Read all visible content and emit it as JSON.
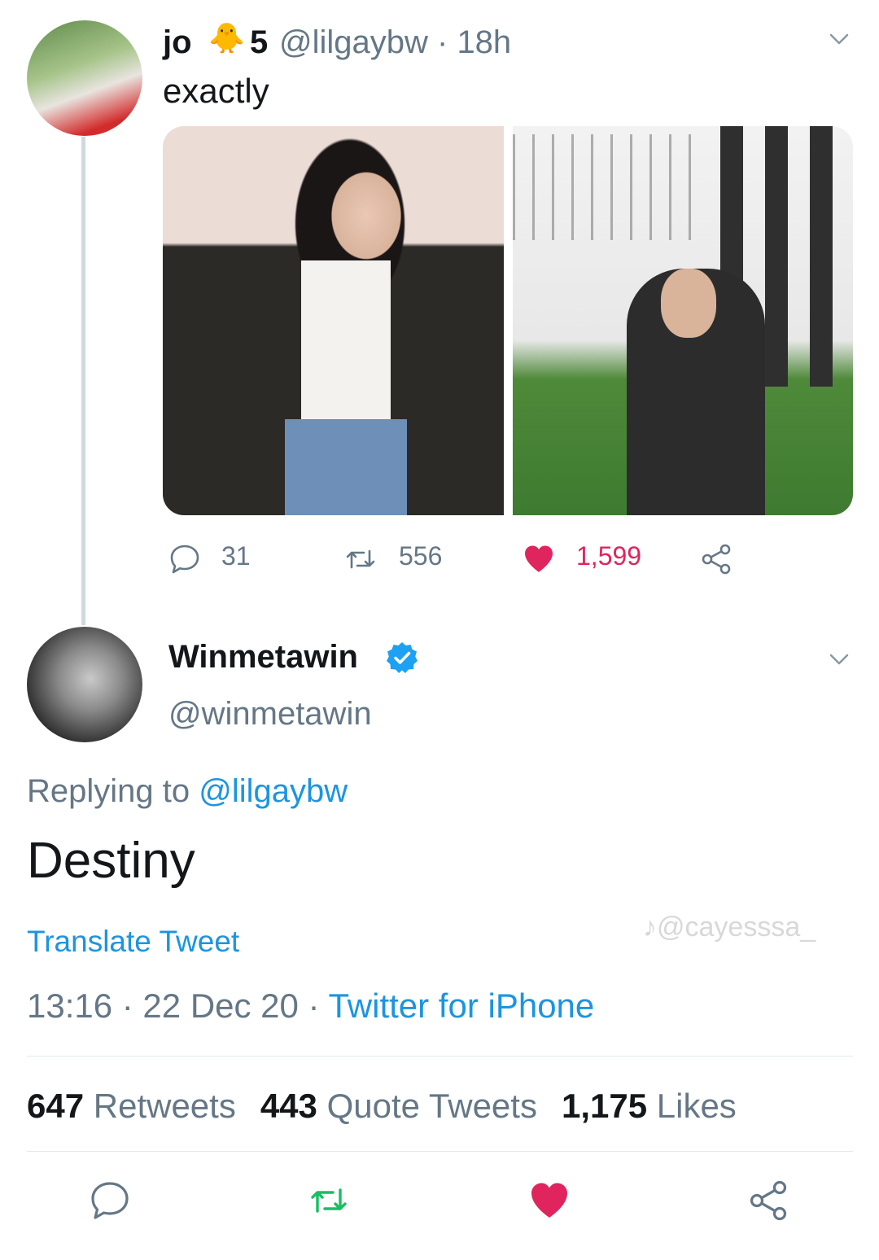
{
  "tweet1": {
    "name": "jo",
    "emoji": "🐥",
    "badge_number": "5",
    "handle_time": "@lilgaybw · 18h",
    "text": "exactly",
    "reply_count": "31",
    "retweet_count": "556",
    "like_count": "1,599"
  },
  "tweet2": {
    "name": "Winmetawin",
    "handle": "@winmetawin",
    "replying_prefix": "Replying to ",
    "replying_handle": "@lilgaybw",
    "text": "Destiny",
    "translate": "Translate Tweet",
    "time_date": "13:16 · 22 Dec 20 · ",
    "source": "Twitter for iPhone",
    "retweets_count": "647",
    "retweets_label": "Retweets",
    "quotes_count": "443",
    "quotes_label": "Quote Tweets",
    "likes_count": "1,175",
    "likes_label": "Likes"
  },
  "watermark": "♪@cayesssa_",
  "colors": {
    "like": "#e0245e",
    "retweet": "#17bf63",
    "link": "#1b95e0",
    "muted": "#657786"
  }
}
